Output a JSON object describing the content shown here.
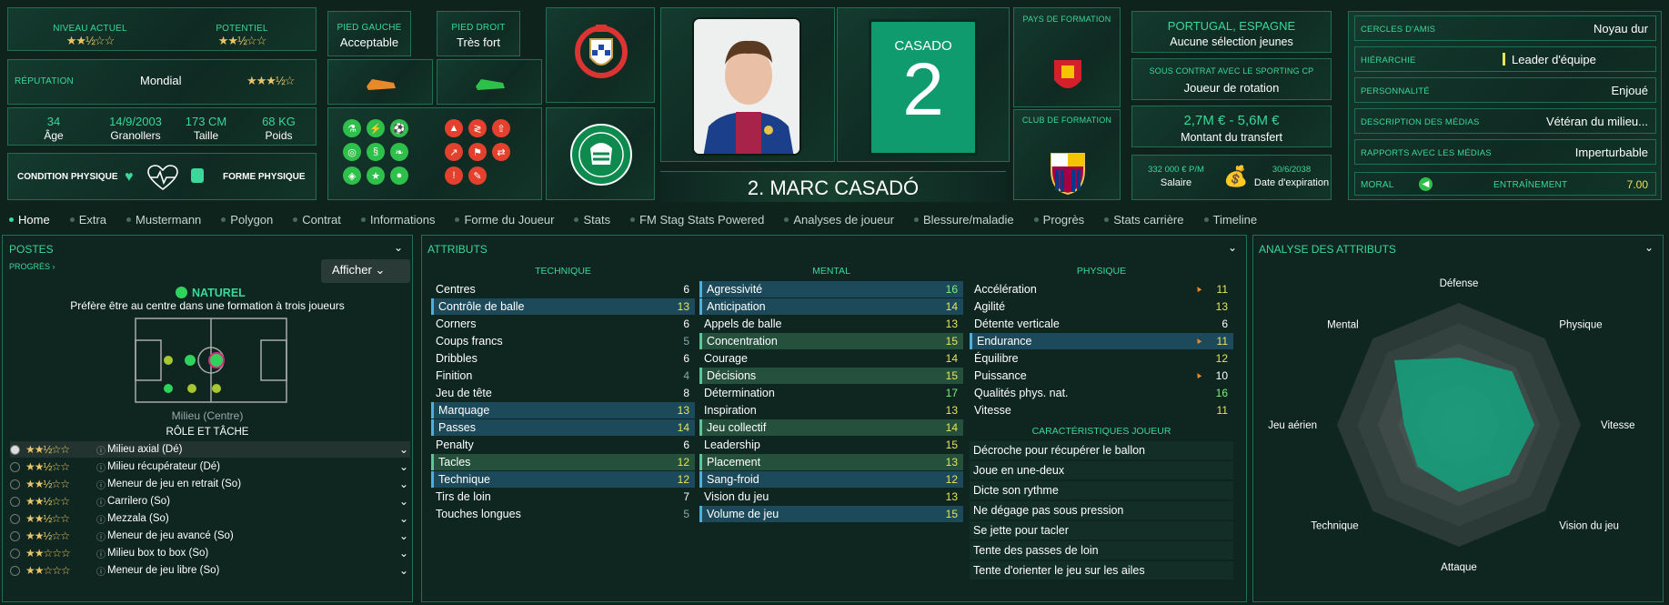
{
  "level": {
    "current_label": "NIVEAU ACTUEL",
    "current_stars": "★★½☆☆",
    "potential_label": "POTENTIEL",
    "potential_stars": "★★½☆☆"
  },
  "reputation": {
    "label": "RÉPUTATION",
    "value": "Mondial",
    "stars": "★★★½☆"
  },
  "bio": {
    "age": "34",
    "age_label": "Âge",
    "dob": "14/9/2003",
    "birthplace": "Granollers",
    "height": "173 CM",
    "height_label": "Taille",
    "weight": "68 KG",
    "weight_label": "Poids"
  },
  "condition": {
    "label": "CONDITION PHYSIQUE",
    "form_label": "FORME PHYSIQUE"
  },
  "feet": {
    "left_label": "PIED GAUCHE",
    "left_value": "Acceptable",
    "right_label": "PIED DROIT",
    "right_value": "Très fort"
  },
  "player": {
    "shirt_name": "CASADO",
    "number": "2",
    "full_name": "2. MARC CASADÓ"
  },
  "formation_country": {
    "label": "PAYS DE FORMATION"
  },
  "formation_club": {
    "label": "CLUB DE FORMATION"
  },
  "nationality": {
    "countries": "PORTUGAL, ESPAGNE",
    "selection": "Aucune sélection jeunes"
  },
  "contract": {
    "label": "SOUS CONTRAT AVEC LE SPORTING CP",
    "status": "Joueur de rotation",
    "value_range": "2,7M € - 5,6M €",
    "value_label": "Montant du transfert",
    "salary": "332 000 € P/M",
    "salary_label": "Salaire",
    "expiry": "30/6/2038",
    "expiry_label": "Date d'expiration"
  },
  "personal": [
    {
      "label": "CERCLES D'AMIS",
      "value": "Noyau dur"
    },
    {
      "label": "HIÉRARCHIE",
      "value": "Leader d'équipe"
    },
    {
      "label": "PERSONNALITÉ",
      "value": "Enjoué"
    },
    {
      "label": "DESCRIPTION DES MÉDIAS",
      "value": "Vétéran du milieu..."
    },
    {
      "label": "RAPPORTS AVEC LES MÉDIAS",
      "value": "Imperturbable"
    }
  ],
  "morale": {
    "label": "MORAL",
    "training_label": "ENTRAÎNEMENT",
    "training_value": "7.00"
  },
  "tabs": [
    "Home",
    "Extra",
    "Mustermann",
    "Polygon",
    "Contrat",
    "Informations",
    "Forme du Joueur",
    "Stats",
    "FM Stag Stats Powered",
    "Analyses de joueur",
    "Blessure/maladie",
    "Progrès",
    "Stats carrière",
    "Timeline"
  ],
  "positions": {
    "title": "POSTES",
    "progress": "PROGRÈS ›",
    "show_button": "Afficher",
    "natural": "NATUREL",
    "natural_text": "Préfère être au centre dans une formation à trois joueurs",
    "position": "Milieu (Centre)",
    "role_title": "RÔLE ET TÂCHE",
    "roles": [
      {
        "name": "Milieu axial (Dé)",
        "stars": "★★½☆☆"
      },
      {
        "name": "Milieu récupérateur (Dé)",
        "stars": "★★½☆☆"
      },
      {
        "name": "Meneur de jeu en retrait (So)",
        "stars": "★★½☆☆"
      },
      {
        "name": "Carrilero (So)",
        "stars": "★★½☆☆"
      },
      {
        "name": "Mezzala (So)",
        "stars": "★★½☆☆"
      },
      {
        "name": "Meneur de jeu avancé (So)",
        "stars": "★★½☆☆"
      },
      {
        "name": "Milieu box to box (So)",
        "stars": "★★☆☆☆"
      },
      {
        "name": "Meneur de jeu libre (So)",
        "stars": "★★☆☆☆"
      }
    ]
  },
  "attributes": {
    "title": "ATTRIBUTS",
    "technique_title": "TECHNIQUE",
    "mental_title": "MENTAL",
    "physique_title": "PHYSIQUE",
    "traits_title": "CARACTÉRISTIQUES JOUEUR",
    "technique": [
      {
        "n": "Centres",
        "v": "6"
      },
      {
        "n": "Contrôle de balle",
        "v": "13"
      },
      {
        "n": "Corners",
        "v": "6"
      },
      {
        "n": "Coups francs",
        "v": "5"
      },
      {
        "n": "Dribbles",
        "v": "6"
      },
      {
        "n": "Finition",
        "v": "4"
      },
      {
        "n": "Jeu de tête",
        "v": "8"
      },
      {
        "n": "Marquage",
        "v": "13"
      },
      {
        "n": "Passes",
        "v": "14"
      },
      {
        "n": "Penalty",
        "v": "6"
      },
      {
        "n": "Tacles",
        "v": "12"
      },
      {
        "n": "Technique",
        "v": "12"
      },
      {
        "n": "Tirs de loin",
        "v": "7"
      },
      {
        "n": "Touches longues",
        "v": "5"
      }
    ],
    "mental": [
      {
        "n": "Agressivité",
        "v": "16"
      },
      {
        "n": "Anticipation",
        "v": "14"
      },
      {
        "n": "Appels de balle",
        "v": "13"
      },
      {
        "n": "Concentration",
        "v": "15"
      },
      {
        "n": "Courage",
        "v": "14"
      },
      {
        "n": "Décisions",
        "v": "15"
      },
      {
        "n": "Détermination",
        "v": "17"
      },
      {
        "n": "Inspiration",
        "v": "13"
      },
      {
        "n": "Jeu collectif",
        "v": "14"
      },
      {
        "n": "Leadership",
        "v": "15"
      },
      {
        "n": "Placement",
        "v": "13"
      },
      {
        "n": "Sang-froid",
        "v": "12"
      },
      {
        "n": "Vision du jeu",
        "v": "13"
      },
      {
        "n": "Volume de jeu",
        "v": "15"
      }
    ],
    "physique": [
      {
        "n": "Accélération",
        "v": "11"
      },
      {
        "n": "Agilité",
        "v": "13"
      },
      {
        "n": "Détente verticale",
        "v": "6"
      },
      {
        "n": "Endurance",
        "v": "11"
      },
      {
        "n": "Équilibre",
        "v": "12"
      },
      {
        "n": "Puissance",
        "v": "10"
      },
      {
        "n": "Qualités phys. nat.",
        "v": "16"
      },
      {
        "n": "Vitesse",
        "v": "11"
      }
    ],
    "traits": [
      "Décroche pour récupérer le ballon",
      "Joue en une-deux",
      "Dicte son rythme",
      "Ne dégage pas sous pression",
      "Se jette pour tacler",
      "Tente des passes de loin",
      "Tente d'orienter le jeu sur les ailes"
    ]
  },
  "analysis": {
    "title": "ANALYSE DES ATTRIBUTS",
    "axes": [
      "Défense",
      "Physique",
      "Vitesse",
      "Vision du jeu",
      "Attaque",
      "Technique",
      "Jeu aérien",
      "Mental"
    ],
    "values": [
      0.55,
      0.62,
      0.62,
      0.58,
      0.55,
      0.48,
      0.45,
      0.75
    ]
  },
  "colors": {
    "accent": "#3bd79b",
    "panel_border": "#1f6e55",
    "highlight_blue": "#1d4a5a",
    "highlight_green": "#24503c",
    "radar_fill": "#14a37f"
  }
}
